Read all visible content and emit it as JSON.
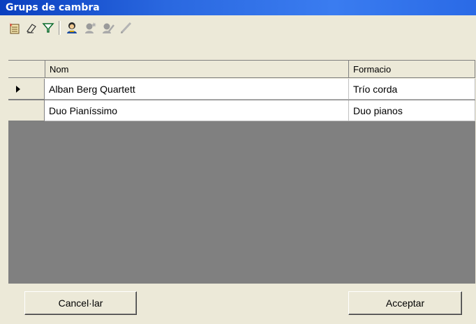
{
  "window": {
    "title": "Grups de cambra"
  },
  "toolbar": {
    "buttons": [
      {
        "icon": "new-record-icon"
      },
      {
        "icon": "eraser-icon"
      },
      {
        "icon": "filter-icon"
      },
      {
        "icon": "person-icon"
      },
      {
        "icon": "person-add-icon",
        "disabled": true
      },
      {
        "icon": "person-edit-icon",
        "disabled": true
      },
      {
        "icon": "pencil-icon",
        "disabled": true
      }
    ]
  },
  "grid": {
    "columns": [
      "Nom",
      "Formacio"
    ],
    "rows": [
      {
        "current": true,
        "nom": "Alban Berg Quartett",
        "formacio": "Trío corda"
      },
      {
        "current": false,
        "nom": "Duo Pianíssimo",
        "formacio": "Duo pianos"
      }
    ]
  },
  "footer": {
    "cancel_label": "Cancel·lar",
    "accept_label": "Acceptar"
  }
}
